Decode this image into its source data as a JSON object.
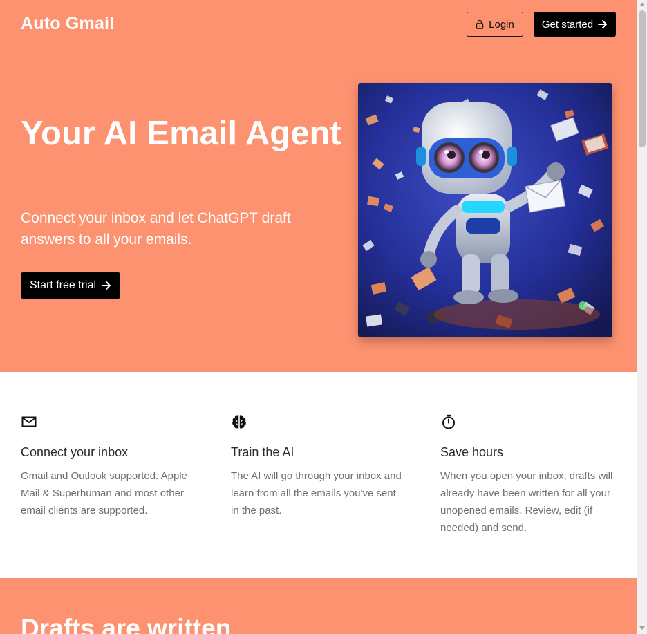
{
  "header": {
    "brand": "Auto Gmail",
    "login_label": "Login",
    "get_started_label": "Get started"
  },
  "hero": {
    "title": "Your AI Email Agent",
    "subtitle": "Connect your inbox and let ChatGPT draft answers to all your emails.",
    "cta_label": "Start free trial"
  },
  "features": [
    {
      "icon": "mail-icon",
      "title": "Connect your inbox",
      "text": "Gmail and Outlook supported. Apple Mail & Superhuman and most other email clients are supported."
    },
    {
      "icon": "brain-icon",
      "title": "Train the AI",
      "text": "The AI will go through your inbox and learn from all the emails you've sent in the past."
    },
    {
      "icon": "stopwatch-icon",
      "title": "Save hours",
      "text": "When you open your inbox, drafts will already have been written for all your unopened emails. Review, edit (if needed) and send."
    }
  ],
  "section2": {
    "heading": "Drafts are written"
  },
  "colors": {
    "accent": "#fd9270",
    "button_dark": "#000000",
    "text_muted": "#6f6f6f"
  }
}
